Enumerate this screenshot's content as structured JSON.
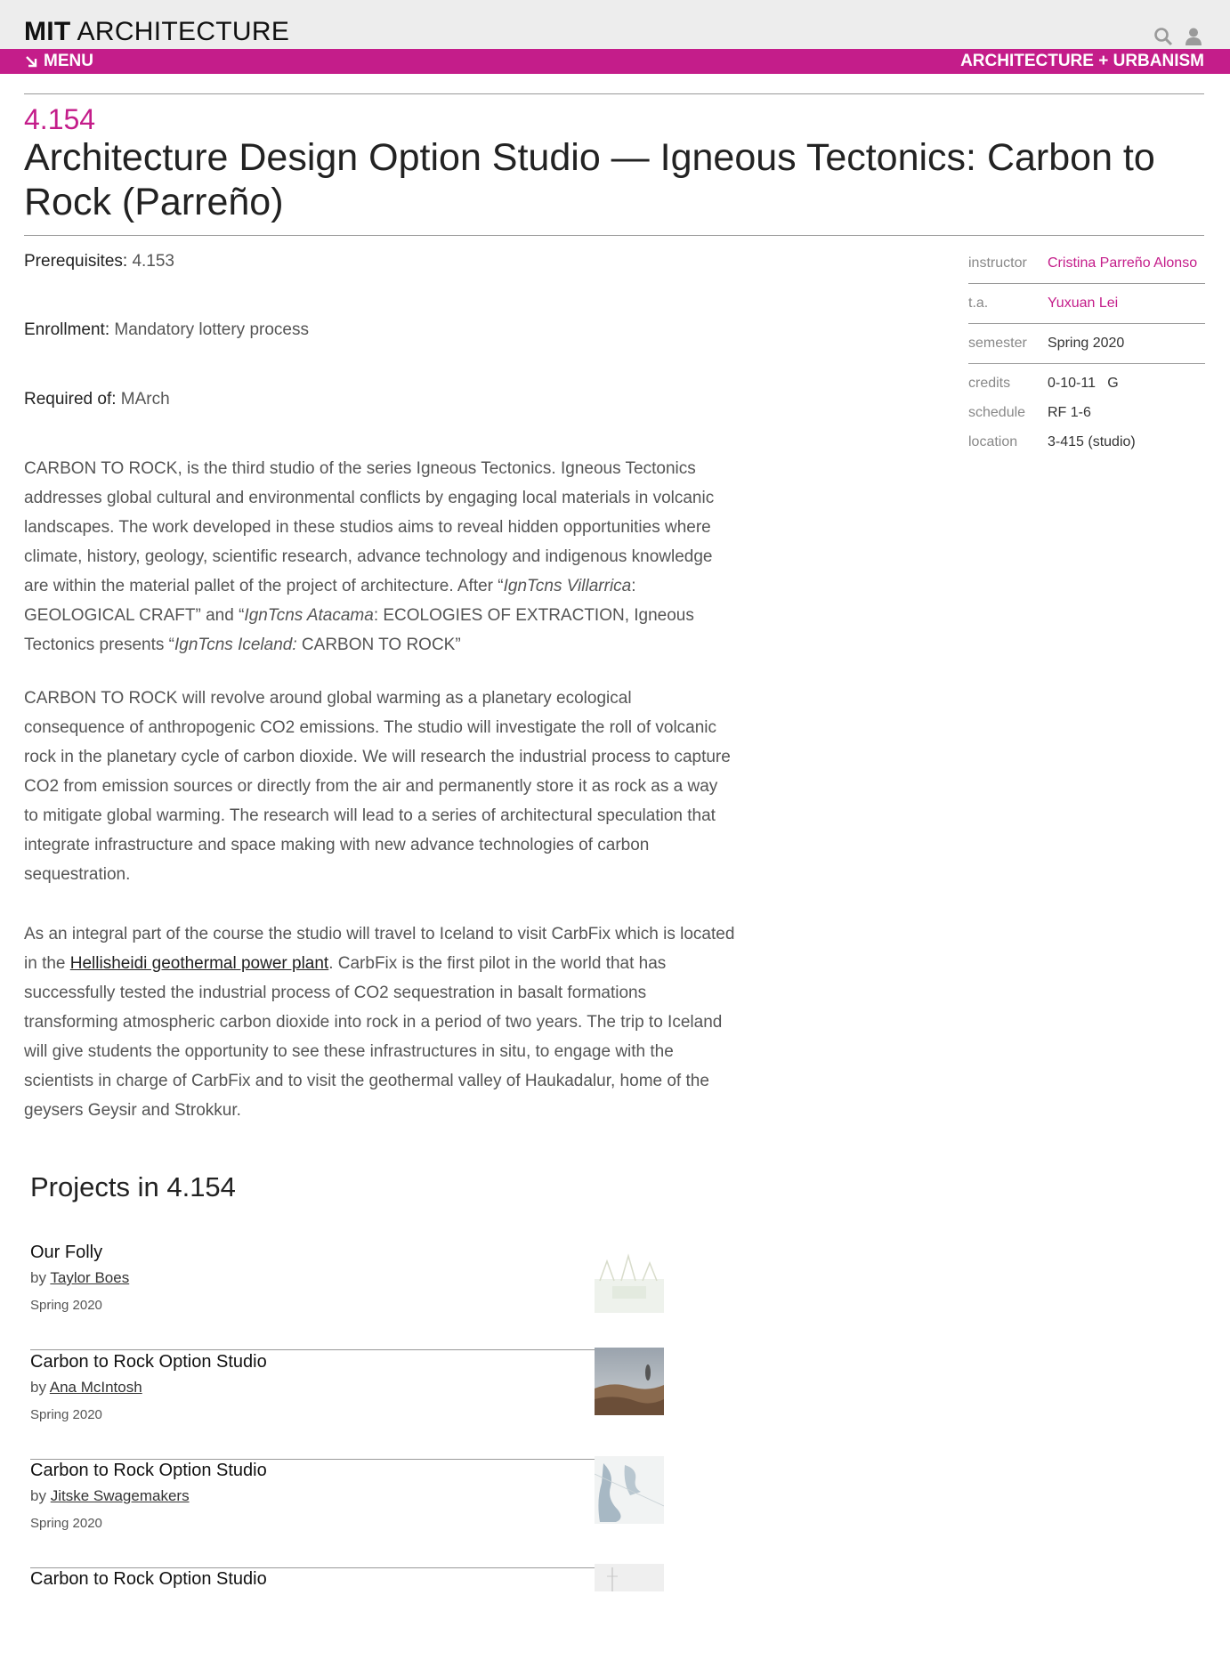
{
  "header": {
    "logo_bold": "MIT",
    "logo_rest": " ARCHITECTURE",
    "menu_label": "MENU",
    "section_label": "ARCHITECTURE + URBANISM",
    "icons": [
      "search-icon",
      "user-icon",
      "menu-arrow-icon"
    ],
    "brand_color": "#c41d8a"
  },
  "course": {
    "number": "4.154",
    "title": "Architecture Design Option Studio — Igneous Tectonics: Carbon to Rock (Parreño)",
    "prerequisites_label": "Prerequisites:",
    "prerequisites_value": " 4.153",
    "enrollment_label": "Enrollment:",
    "enrollment_value": " Mandatory lottery process",
    "required_label": "Required of:",
    "required_value": " MArch"
  },
  "description": {
    "p1_a": "CARBON TO ROCK, is the third studio of the series Igneous Tectonics. Igneous Tectonics addresses global cultural and environmental conflicts by engaging local materials in volcanic landscapes. The work developed in these studios aims to reveal hidden opportunities where climate, history, geology, scientific research, advance technology and indigenous knowledge are within the material pallet of the project of architecture. After “",
    "p1_i1": "IgnTcns Villarrica",
    "p1_b": ": GEOLOGICAL CRAFT” and “",
    "p1_i2": "IgnTcns Atacama",
    "p1_c": ": ECOLOGIES OF EXTRACTION, Igneous Tectonics presents “",
    "p1_i3": "IgnTcns Iceland:",
    "p1_d": " CARBON TO ROCK”",
    "p2": "CARBON TO ROCK will revolve around global warming as a planetary ecological consequence of anthropogenic CO2 emissions. The studio will investigate the roll of volcanic rock in the planetary cycle of carbon dioxide.  We will research the industrial process to capture CO2 from emission sources or directly from the air and permanently store it as rock as a way to mitigate global warming. The research will lead to a series of architectural speculation that integrate infrastructure and space making with new advance technologies of carbon sequestration.",
    "p3_a": "As an integral part of the course the studio will travel to Iceland to visit CarbFix which is located in the ",
    "p3_link": "Hellisheidi geothermal power plant",
    "p3_b": ". CarbFix is the first pilot in the world that has successfully tested the industrial process of CO2 sequestration in basalt formations transforming atmospheric carbon dioxide into rock in a period of two years. The trip to Iceland will give students the opportunity to see these infrastructures in situ, to engage with the scientists in charge of CarbFix and to visit the geothermal valley of Haukadalur, home of the geysers Geysir and Strokkur."
  },
  "sidebar": {
    "instructor_label": "instructor",
    "instructor_value": "Cristina Parreño Alonso",
    "ta_label": "t.a.",
    "ta_value": "Yuxuan Lei",
    "semester_label": "semester",
    "semester_value": "Spring 2020",
    "credits_label": "credits",
    "credits_value": "0-10-11   G",
    "schedule_label": "schedule",
    "schedule_value": "RF 1-6",
    "location_label": "location",
    "location_value": "3-415 (studio)"
  },
  "projects": {
    "heading": "Projects in 4.154",
    "items": [
      {
        "title": "Our Folly",
        "by": "by ",
        "author": "Taylor Boes",
        "semester": "Spring 2020"
      },
      {
        "title": "Carbon to Rock Option Studio",
        "by": "by ",
        "author": "Ana McIntosh",
        "semester": "Spring 2020"
      },
      {
        "title": "Carbon to Rock Option Studio",
        "by": "by ",
        "author": "Jitske Swagemakers",
        "semester": "Spring 2020"
      },
      {
        "title": "Carbon to Rock Option Studio",
        "by": "",
        "author": "",
        "semester": ""
      }
    ]
  }
}
